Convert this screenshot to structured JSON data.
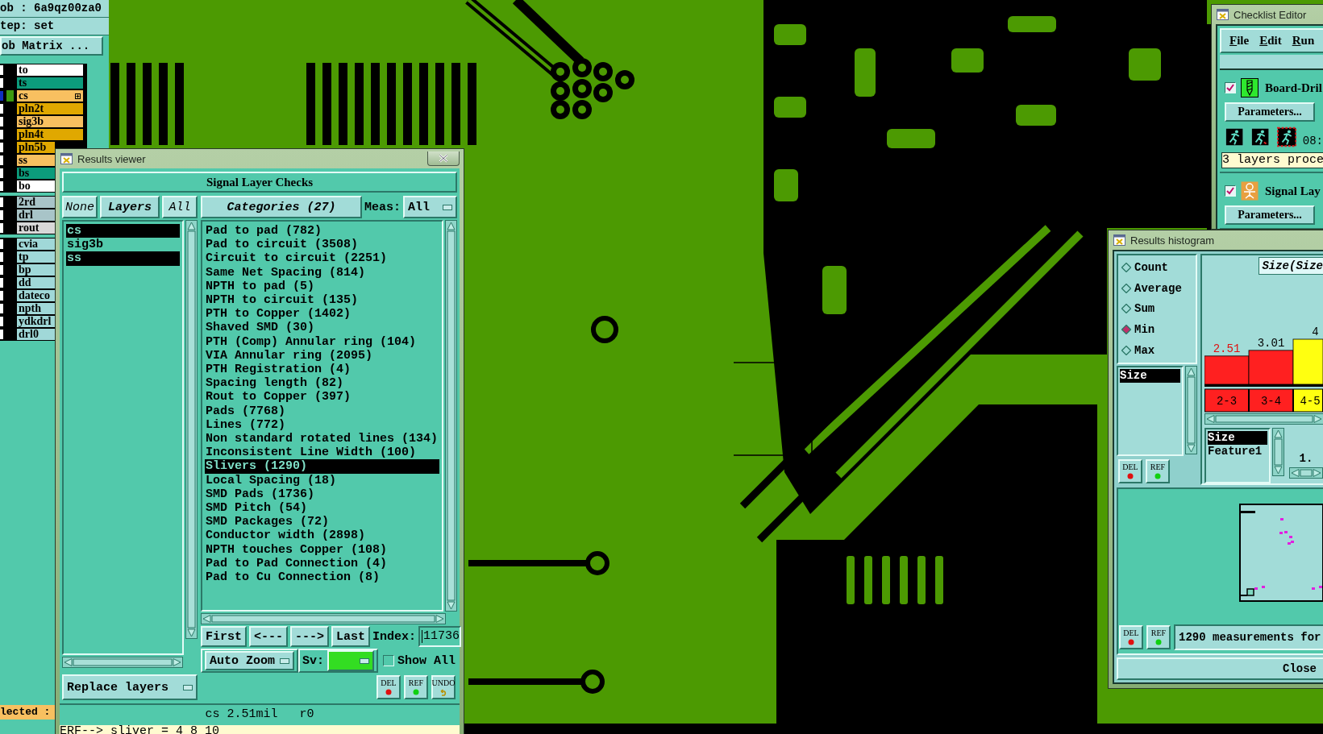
{
  "job_panel": {
    "job": "ob : 6a9qz00za0",
    "step": "tep: set",
    "matrix_button": "ob Matrix ...",
    "layer_groups": [
      {
        "layers": [
          {
            "name": "to",
            "color": "#ffffff",
            "selected": false
          },
          {
            "name": "ts",
            "color": "#0c9c7c",
            "selected": false
          },
          {
            "name": "cs",
            "color": "#f8c060",
            "selected": true
          },
          {
            "name": "pln2t",
            "color": "#e0a800",
            "selected": false
          },
          {
            "name": "sig3b",
            "color": "#f8c060",
            "selected": false
          },
          {
            "name": "pln4t",
            "color": "#e0a800",
            "selected": false
          },
          {
            "name": "pln5b",
            "color": "#e0a800",
            "selected": false
          },
          {
            "name": "ss",
            "color": "#f8c060",
            "selected": false
          },
          {
            "name": "bs",
            "color": "#0c9c7c",
            "selected": false
          },
          {
            "name": "bo",
            "color": "#ffffff",
            "selected": false
          }
        ]
      },
      {
        "layers": [
          {
            "name": "2rd",
            "color": "#a8c4c8",
            "selected": false
          },
          {
            "name": "drl",
            "color": "#a8c4c8",
            "selected": false
          },
          {
            "name": "rout",
            "color": "#d8d8d8",
            "selected": false
          }
        ]
      },
      {
        "layers": [
          {
            "name": "cvia",
            "color": "#a0d8d8",
            "selected": false
          },
          {
            "name": "tp",
            "color": "#a0d8d8",
            "selected": false
          },
          {
            "name": "bp",
            "color": "#a0d8d8",
            "selected": false
          },
          {
            "name": "dd",
            "color": "#a0d8d8",
            "selected": false
          },
          {
            "name": "dateco",
            "color": "#a0d8d8",
            "selected": false
          },
          {
            "name": "npth",
            "color": "#a0d8d8",
            "selected": false
          },
          {
            "name": "ydkdrl",
            "color": "#a0d8d8",
            "selected": false
          },
          {
            "name": "drl0",
            "color": "#a0d8d8",
            "selected": false
          }
        ]
      }
    ],
    "status": "lected :"
  },
  "results_viewer": {
    "title": "Results viewer",
    "header": "Signal Layer Checks",
    "layer_buttons": [
      {
        "label": "None",
        "kind": "toggle"
      },
      {
        "label": "Layers",
        "kind": "heading"
      },
      {
        "label": "All",
        "kind": "toggle"
      }
    ],
    "layers": [
      {
        "name": "cs",
        "selected": true
      },
      {
        "name": "sig3b",
        "selected": false
      },
      {
        "name": "ss",
        "selected": true
      }
    ],
    "categories_button": "Categories (27)",
    "meas_label": "Meas:",
    "meas_value": "All",
    "categories": [
      {
        "label": "Pad to pad (782)",
        "selected": false
      },
      {
        "label": "Pad to circuit (3508)",
        "selected": false
      },
      {
        "label": "Circuit to circuit (2251)",
        "selected": false
      },
      {
        "label": "Same Net Spacing (814)",
        "selected": false
      },
      {
        "label": "NPTH to pad (5)",
        "selected": false
      },
      {
        "label": "NPTH to circuit (135)",
        "selected": false
      },
      {
        "label": "PTH to Copper (1402)",
        "selected": false
      },
      {
        "label": "Shaved SMD (30)",
        "selected": false
      },
      {
        "label": "PTH (Comp) Annular ring (104)",
        "selected": false
      },
      {
        "label": "VIA Annular ring (2095)",
        "selected": false
      },
      {
        "label": "PTH Registration (4)",
        "selected": false
      },
      {
        "label": "Spacing length (82)",
        "selected": false
      },
      {
        "label": "Rout to Copper (397)",
        "selected": false
      },
      {
        "label": "Pads (7768)",
        "selected": false
      },
      {
        "label": "Lines (772)",
        "selected": false
      },
      {
        "label": "Non standard rotated lines (134)",
        "selected": false
      },
      {
        "label": "Inconsistent Line Width (100)",
        "selected": false
      },
      {
        "label": "Slivers (1290)",
        "selected": true
      },
      {
        "label": "Local Spacing (18)",
        "selected": false
      },
      {
        "label": "SMD Pads (1736)",
        "selected": false
      },
      {
        "label": "SMD Pitch (54)",
        "selected": false
      },
      {
        "label": "SMD Packages (72)",
        "selected": false
      },
      {
        "label": "Conductor width (2898)",
        "selected": false
      },
      {
        "label": "NPTH touches Copper (108)",
        "selected": false
      },
      {
        "label": "Pad to Pad Connection (4)",
        "selected": false
      },
      {
        "label": "Pad to Cu Connection (8)",
        "selected": false
      }
    ],
    "nav_buttons": [
      "First",
      "<---",
      "--->",
      "Last"
    ],
    "index_label": "Index:",
    "index_value": "11736",
    "zoom_mode": "Auto Zoom",
    "sv_label": "Sv:",
    "show_all": {
      "label": "Show All",
      "checked": false
    },
    "replace_mode": "Replace layers",
    "action_buttons": [
      {
        "label": "DEL",
        "kind": "delete"
      },
      {
        "label": "REF",
        "kind": "refresh"
      },
      {
        "label": "UNDO",
        "kind": "undo"
      }
    ],
    "status": "cs 2.51mil   r0",
    "command": "ERF--> sliver = 4 8 10"
  },
  "checklist_editor": {
    "title": "Checklist Editor",
    "menu": [
      "File",
      "Edit",
      "Run"
    ],
    "checks": [
      {
        "name": "Board-Dril",
        "checked": true,
        "kind": "drill",
        "button": "Parameters...",
        "time": "08:",
        "message": "3 layers proce"
      },
      {
        "name": "Signal Lay",
        "checked": true,
        "kind": "signal",
        "button": "Parameters..."
      }
    ]
  },
  "histogram": {
    "title": "Results histogram",
    "modes": [
      {
        "label": "Count",
        "selected": false
      },
      {
        "label": "Average",
        "selected": false
      },
      {
        "label": "Sum",
        "selected": false
      },
      {
        "label": "Min",
        "selected": true
      },
      {
        "label": "Max",
        "selected": false
      }
    ],
    "fields": [
      {
        "label": "Size",
        "selected": true
      }
    ],
    "field_buttons": [
      {
        "label": "DEL",
        "kind": "delete"
      },
      {
        "label": "REF",
        "kind": "refresh"
      }
    ],
    "chart_title": "Size(Size",
    "chart_data": {
      "type": "bar",
      "categories": [
        "2-3",
        "3-4",
        "4-5"
      ],
      "series": [
        {
          "color": "#ff2020",
          "values": [
            2.51,
            3.01,
            null
          ]
        },
        {
          "color": "#ffff10",
          "values": [
            null,
            null,
            4
          ]
        }
      ],
      "data_labels": true
    },
    "attributes": [
      {
        "label": "Size",
        "selected": true
      },
      {
        "label": "Feature1",
        "selected": false
      }
    ],
    "scale_value": "1.",
    "plot_buttons": [
      {
        "label": "DEL",
        "kind": "delete"
      },
      {
        "label": "REF",
        "kind": "refresh"
      }
    ],
    "message": "1290 measurements for",
    "close": "Close"
  }
}
